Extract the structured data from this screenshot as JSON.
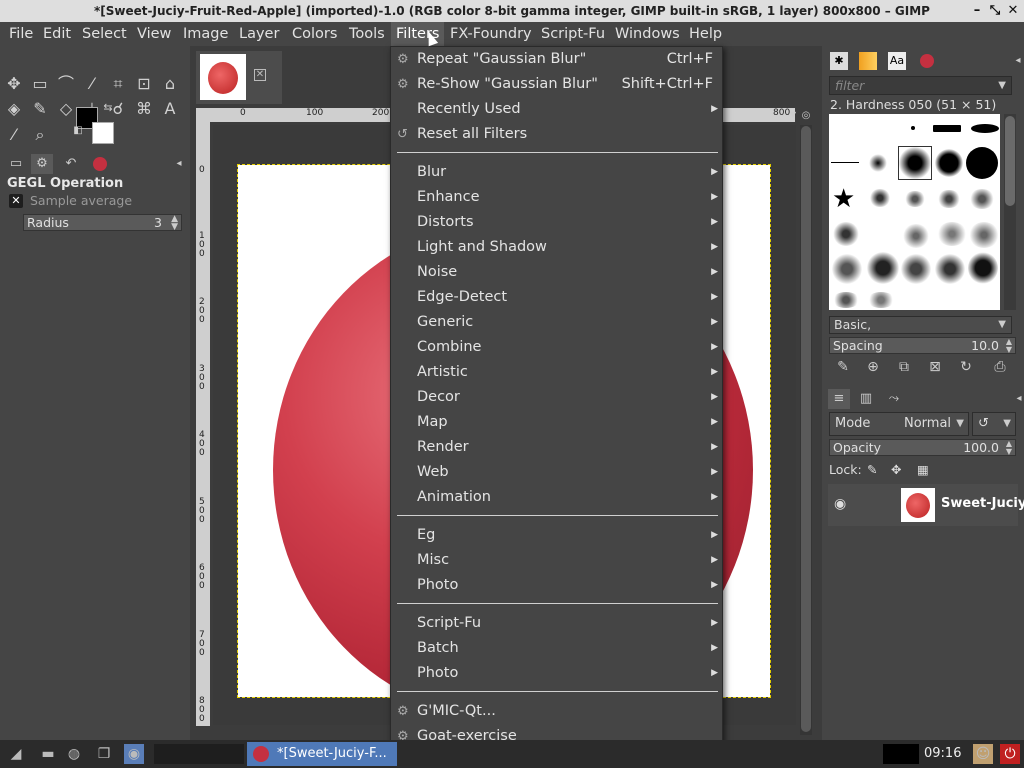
{
  "window": {
    "title": "*[Sweet-Juciy-Fruit-Red-Apple] (imported)-1.0 (RGB color 8-bit gamma integer, GIMP built-in sRGB, 1 layer) 800x800 – GIMP",
    "min_glyph": "–",
    "restore_glyph": "⤡",
    "close_glyph": "✕"
  },
  "menubar": {
    "items": [
      {
        "label": "File"
      },
      {
        "label": "Edit"
      },
      {
        "label": "Select"
      },
      {
        "label": "View"
      },
      {
        "label": "Image"
      },
      {
        "label": "Layer"
      },
      {
        "label": "Colors"
      },
      {
        "label": "Tools"
      },
      {
        "label": "Filters"
      },
      {
        "label": "FX-Foundry"
      },
      {
        "label": "Script-Fu"
      },
      {
        "label": "Windows"
      },
      {
        "label": "Help"
      }
    ]
  },
  "filters_menu": {
    "top": [
      {
        "label": "Repeat \"Gaussian Blur\"",
        "accel": "Ctrl+F"
      },
      {
        "label": "Re-Show \"Gaussian Blur\"",
        "accel": "Shift+Ctrl+F"
      },
      {
        "label": "Recently Used"
      },
      {
        "label": "Reset all Filters"
      }
    ],
    "group1": [
      "Blur",
      "Enhance",
      "Distorts",
      "Light and Shadow",
      "Noise",
      "Edge-Detect",
      "Generic",
      "Combine",
      "Artistic",
      "Decor",
      "Map",
      "Render",
      "Web",
      "Animation"
    ],
    "group2": [
      "Eg",
      "Misc",
      "Photo"
    ],
    "group3": [
      "Script-Fu",
      "Batch",
      "Photo"
    ],
    "group4": [
      "G'MIC-Qt...",
      "Goat-exercise"
    ]
  },
  "tool_options": {
    "title": "GEGL Operation",
    "sample_label": "Sample average",
    "radius_label": "Radius",
    "radius_value": "3"
  },
  "rulers": {
    "top_ticks": [
      "0",
      "100",
      "200",
      "800"
    ],
    "left_ticks": [
      "0",
      "100",
      "200",
      "300",
      "400",
      "500",
      "600",
      "700",
      "800"
    ]
  },
  "brushes": {
    "filter_placeholder": "filter",
    "selected_name": "2. Hardness 050 (51 × 51)",
    "preset": "Basic,",
    "spacing_label": "Spacing",
    "spacing_value": "10.0"
  },
  "layers": {
    "mode_label": "Mode",
    "mode_value": "Normal",
    "opacity_label": "Opacity",
    "opacity_value": "100.0",
    "lock_label": "Lock:",
    "layer_name": "Sweet-Juciy"
  },
  "taskbar": {
    "task_label": "*[Sweet-Juciy-F...",
    "clock": "09:16"
  },
  "colors": {
    "menu_bg": "#454545",
    "highlight": "#5a5a5a",
    "task_active": "#4f79b8"
  }
}
